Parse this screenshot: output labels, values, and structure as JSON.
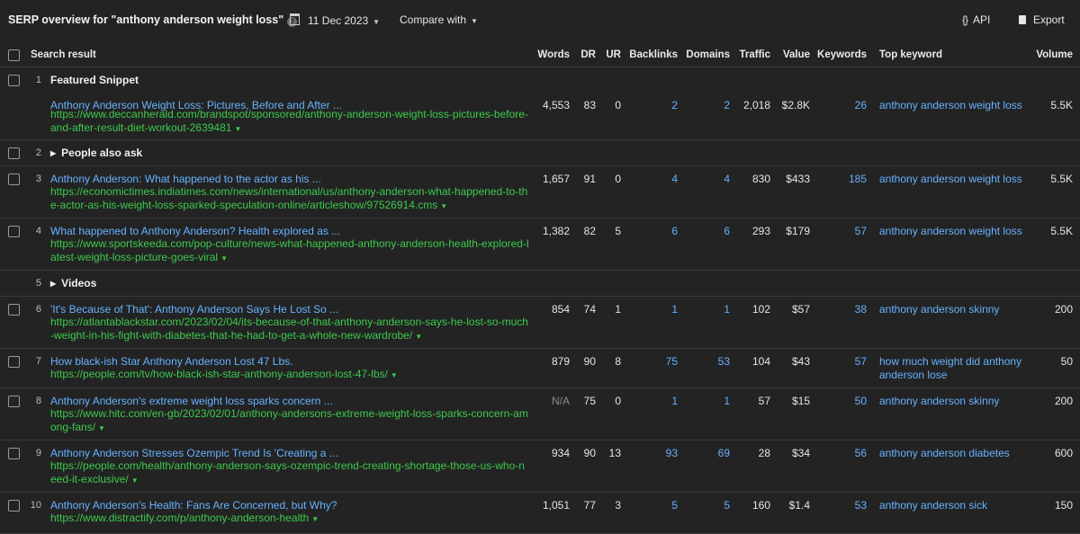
{
  "header": {
    "title": "SERP overview for \"anthony anderson weight loss\"",
    "help": "?",
    "date": "11 Dec 2023",
    "compare": "Compare with",
    "api": "API",
    "api_icon": "{}",
    "export": "Export"
  },
  "columns": {
    "result": "Search result",
    "words": "Words",
    "dr": "DR",
    "ur": "UR",
    "backlinks": "Backlinks",
    "domains": "Domains",
    "traffic": "Traffic",
    "value": "Value",
    "keywords": "Keywords",
    "top_keyword": "Top keyword",
    "volume": "Volume"
  },
  "rows": [
    {
      "num": "1",
      "section": "Featured Snippet"
    },
    {
      "title": "Anthony Anderson Weight Loss: Pictures, Before and After ...",
      "url": "https://www.deccanherald.com/brandspot/sponsored/anthony-anderson-weight-loss-pictures-before-and-after-result-diet-workout-2639481",
      "words": "4,553",
      "dr": "83",
      "ur": "0",
      "backlinks": "2",
      "domains": "2",
      "traffic": "2,018",
      "value": "$2.8K",
      "keywords": "26",
      "top_keyword": "anthony anderson weight loss",
      "volume": "5.5K"
    },
    {
      "num": "2",
      "section": "People also ask"
    },
    {
      "num": "3",
      "title": "Anthony Anderson: What happened to the actor as his ...",
      "url": "https://economictimes.indiatimes.com/news/international/us/anthony-anderson-what-happened-to-the-actor-as-his-weight-loss-sparked-speculation-online/articleshow/97526914.cms",
      "words": "1,657",
      "dr": "91",
      "ur": "0",
      "backlinks": "4",
      "domains": "4",
      "traffic": "830",
      "value": "$433",
      "keywords": "185",
      "top_keyword": "anthony anderson weight loss",
      "volume": "5.5K"
    },
    {
      "num": "4",
      "title": "What happened to Anthony Anderson? Health explored as ...",
      "url": "https://www.sportskeeda.com/pop-culture/news-what-happened-anthony-anderson-health-explored-latest-weight-loss-picture-goes-viral",
      "words": "1,382",
      "dr": "82",
      "ur": "5",
      "backlinks": "6",
      "domains": "6",
      "traffic": "293",
      "value": "$179",
      "keywords": "57",
      "top_keyword": "anthony anderson weight loss",
      "volume": "5.5K"
    },
    {
      "num": "5",
      "section": "Videos"
    },
    {
      "num": "6",
      "title": "'It's Because of That': Anthony Anderson Says He Lost So ...",
      "url": "https://atlantablackstar.com/2023/02/04/its-because-of-that-anthony-anderson-says-he-lost-so-much-weight-in-his-fight-with-diabetes-that-he-had-to-get-a-whole-new-wardrobe/",
      "words": "854",
      "dr": "74",
      "ur": "1",
      "backlinks": "1",
      "domains": "1",
      "traffic": "102",
      "value": "$57",
      "keywords": "38",
      "top_keyword": "anthony anderson skinny",
      "volume": "200"
    },
    {
      "num": "7",
      "title": "How black-ish Star Anthony Anderson Lost 47 Lbs.",
      "url": "https://people.com/tv/how-black-ish-star-anthony-anderson-lost-47-lbs/",
      "words": "879",
      "dr": "90",
      "ur": "8",
      "backlinks": "75",
      "domains": "53",
      "traffic": "104",
      "value": "$43",
      "keywords": "57",
      "top_keyword": "how much weight did anthony anderson lose",
      "volume": "50"
    },
    {
      "num": "8",
      "title": "Anthony Anderson's extreme weight loss sparks concern ...",
      "url": "https://www.hitc.com/en-gb/2023/02/01/anthony-andersons-extreme-weight-loss-sparks-concern-among-fans/",
      "words": "N/A",
      "dr": "75",
      "ur": "0",
      "backlinks": "1",
      "domains": "1",
      "traffic": "57",
      "value": "$15",
      "keywords": "50",
      "top_keyword": "anthony anderson skinny",
      "volume": "200"
    },
    {
      "num": "9",
      "title": "Anthony Anderson Stresses Ozempic Trend Is 'Creating a ...",
      "url": "https://people.com/health/anthony-anderson-says-ozempic-trend-creating-shortage-those-us-who-need-it-exclusive/",
      "words": "934",
      "dr": "90",
      "ur": "13",
      "backlinks": "93",
      "domains": "69",
      "traffic": "28",
      "value": "$34",
      "keywords": "56",
      "top_keyword": "anthony anderson diabetes",
      "volume": "600"
    },
    {
      "num": "10",
      "title": "Anthony Anderson's Health: Fans Are Concerned, but Why?",
      "url": "https://www.distractify.com/p/anthony-anderson-health",
      "words": "1,051",
      "dr": "77",
      "ur": "3",
      "backlinks": "5",
      "domains": "5",
      "traffic": "160",
      "value": "$1.4",
      "keywords": "53",
      "top_keyword": "anthony anderson sick",
      "volume": "150"
    }
  ],
  "colors": {
    "background": "#232323",
    "link": "#66b2ff",
    "url": "#3ccb4c"
  }
}
